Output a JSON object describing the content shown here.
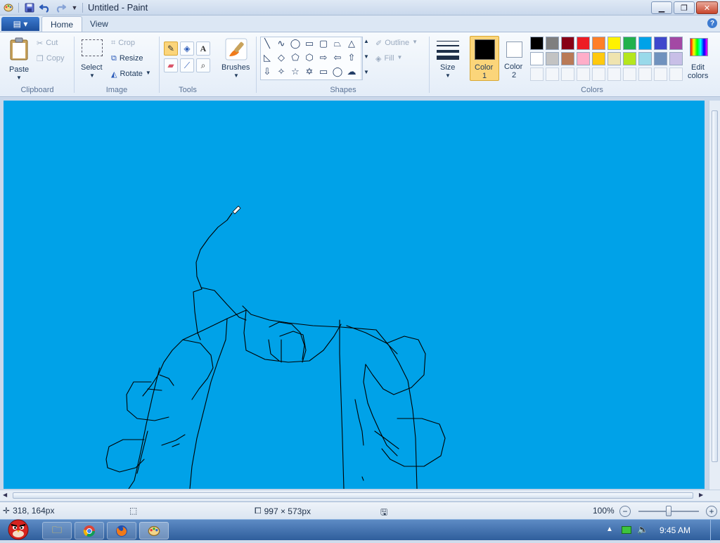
{
  "window": {
    "title": "Untitled - Paint"
  },
  "tabs": {
    "home": "Home",
    "view": "View"
  },
  "clipboard": {
    "paste": "Paste",
    "cut": "Cut",
    "copy": "Copy",
    "group": "Clipboard"
  },
  "image": {
    "select": "Select",
    "crop": "Crop",
    "resize": "Resize",
    "rotate": "Rotate",
    "group": "Image"
  },
  "tools": {
    "group": "Tools"
  },
  "brushes": {
    "label": "Brushes"
  },
  "shapes": {
    "outline": "Outline",
    "fill": "Fill",
    "group": "Shapes"
  },
  "size": {
    "label": "Size"
  },
  "color1": {
    "line1": "Color",
    "line2": "1",
    "value": "#000000"
  },
  "color2": {
    "line1": "Color",
    "line2": "2",
    "value": "#ffffff"
  },
  "colors": {
    "group": "Colors",
    "edit_line1": "Edit",
    "edit_line2": "colors",
    "row1": [
      "#000000",
      "#7f7f7f",
      "#880015",
      "#ed1c24",
      "#ff7f27",
      "#fff200",
      "#22b14c",
      "#00a2e8",
      "#3f48cc",
      "#a349a4"
    ],
    "row2": [
      "#ffffff",
      "#c3c3c3",
      "#b97a57",
      "#ffaec9",
      "#ffc90e",
      "#efe4b0",
      "#b5e61d",
      "#99d9ea",
      "#7092be",
      "#c8bfe7"
    ]
  },
  "canvas": {
    "background": "#00a2e8"
  },
  "status": {
    "cursor_pos": "318, 164px",
    "canvas_size": "997 × 573px",
    "zoom": "100%",
    "zoom_level": 0.5
  },
  "taskbar": {
    "clock": "9:45 AM"
  }
}
